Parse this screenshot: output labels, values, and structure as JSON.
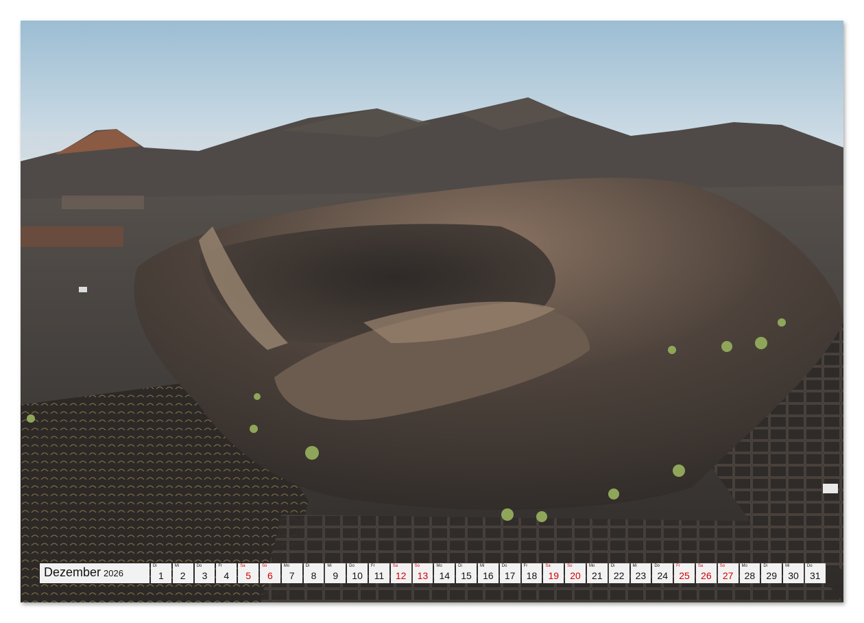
{
  "calendar": {
    "month": "Dezember",
    "year": "2026",
    "days": [
      {
        "abbr": "Di",
        "num": "1",
        "weekend": false
      },
      {
        "abbr": "Mi",
        "num": "2",
        "weekend": false
      },
      {
        "abbr": "Do",
        "num": "3",
        "weekend": false
      },
      {
        "abbr": "Fr",
        "num": "4",
        "weekend": false
      },
      {
        "abbr": "Sa",
        "num": "5",
        "weekend": true
      },
      {
        "abbr": "So",
        "num": "6",
        "weekend": true
      },
      {
        "abbr": "Mo",
        "num": "7",
        "weekend": false
      },
      {
        "abbr": "Di",
        "num": "8",
        "weekend": false
      },
      {
        "abbr": "Mi",
        "num": "9",
        "weekend": false
      },
      {
        "abbr": "Do",
        "num": "10",
        "weekend": false
      },
      {
        "abbr": "Fr",
        "num": "11",
        "weekend": false
      },
      {
        "abbr": "Sa",
        "num": "12",
        "weekend": true
      },
      {
        "abbr": "So",
        "num": "13",
        "weekend": true
      },
      {
        "abbr": "Mo",
        "num": "14",
        "weekend": false
      },
      {
        "abbr": "Di",
        "num": "15",
        "weekend": false
      },
      {
        "abbr": "Mi",
        "num": "16",
        "weekend": false
      },
      {
        "abbr": "Do",
        "num": "17",
        "weekend": false
      },
      {
        "abbr": "Fr",
        "num": "18",
        "weekend": false
      },
      {
        "abbr": "Sa",
        "num": "19",
        "weekend": true
      },
      {
        "abbr": "So",
        "num": "20",
        "weekend": true
      },
      {
        "abbr": "Mo",
        "num": "21",
        "weekend": false
      },
      {
        "abbr": "Di",
        "num": "22",
        "weekend": false
      },
      {
        "abbr": "Mi",
        "num": "23",
        "weekend": false
      },
      {
        "abbr": "Do",
        "num": "24",
        "weekend": false
      },
      {
        "abbr": "Fr",
        "num": "25",
        "weekend": true
      },
      {
        "abbr": "Sa",
        "num": "26",
        "weekend": true
      },
      {
        "abbr": "So",
        "num": "27",
        "weekend": true
      },
      {
        "abbr": "Mo",
        "num": "28",
        "weekend": false
      },
      {
        "abbr": "Di",
        "num": "29",
        "weekend": false
      },
      {
        "abbr": "Mi",
        "num": "30",
        "weekend": false
      },
      {
        "abbr": "Do",
        "num": "31",
        "weekend": false
      }
    ]
  },
  "colors": {
    "page_background": "#ffffff",
    "sky_top": "#9fc0d6",
    "sky_horizon": "#e3e9ec",
    "volcanic_ground": "#3a3633",
    "crater_rim": "#6e5f52",
    "weekend_text": "#d00000",
    "calendar_cell": "#f2f2f2"
  }
}
